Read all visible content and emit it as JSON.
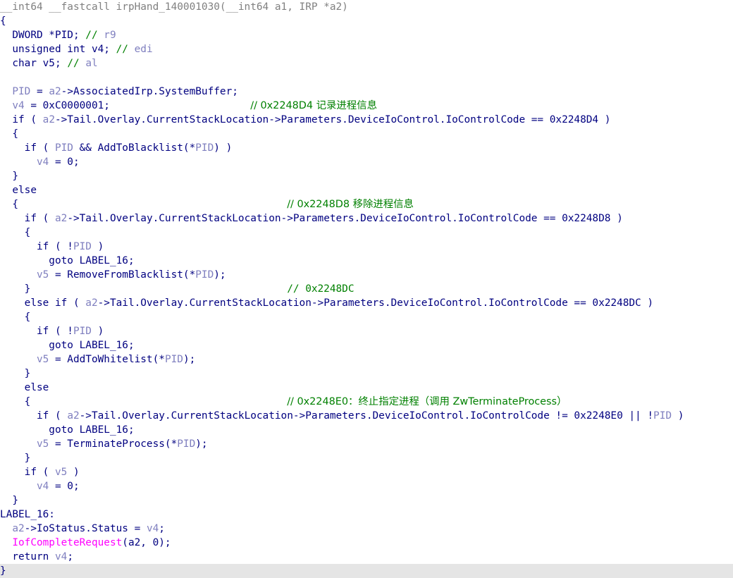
{
  "colors": {
    "default": "#000080",
    "variable": "#7f7fbf",
    "comment": "#008000",
    "import": "#ff00ff",
    "gray": "#808080",
    "selected_line_bg": "#e5e5e5"
  },
  "lines": [
    [
      {
        "t": "gray",
        "s": "__int64 __fastcall irpHand_140001030(__int64 a1, IRP *a2)"
      }
    ],
    [
      {
        "t": "sym",
        "s": "{"
      }
    ],
    [
      {
        "t": "plain",
        "s": "  DWORD *PID; "
      },
      {
        "t": "com",
        "s": "// "
      },
      {
        "t": "var",
        "s": "r9"
      }
    ],
    [
      {
        "t": "plain",
        "s": "  unsigned int v4; "
      },
      {
        "t": "com",
        "s": "// "
      },
      {
        "t": "var",
        "s": "edi"
      }
    ],
    [
      {
        "t": "plain",
        "s": "  char v5; "
      },
      {
        "t": "com",
        "s": "// "
      },
      {
        "t": "var",
        "s": "al"
      }
    ],
    [],
    [
      {
        "t": "plain",
        "s": "  "
      },
      {
        "t": "var",
        "s": "PID"
      },
      {
        "t": "plain",
        "s": " = "
      },
      {
        "t": "var",
        "s": "a2"
      },
      {
        "t": "plain",
        "s": "->AssociatedIrp.SystemBuffer;"
      }
    ],
    [
      {
        "t": "plain",
        "s": "  "
      },
      {
        "t": "var",
        "s": "v4"
      },
      {
        "t": "plain",
        "s": " = 0xC0000001;                       "
      },
      {
        "t": "com",
        "s": "// 0x2248D4 记录进程信息"
      }
    ],
    [
      {
        "t": "plain",
        "s": "  if ( "
      },
      {
        "t": "var",
        "s": "a2"
      },
      {
        "t": "plain",
        "s": "->Tail.Overlay.CurrentStackLocation->Parameters.DeviceIoControl.IoControlCode == 0x2248D4 )"
      }
    ],
    [
      {
        "t": "plain",
        "s": "  {"
      }
    ],
    [
      {
        "t": "plain",
        "s": "    if ( "
      },
      {
        "t": "var",
        "s": "PID"
      },
      {
        "t": "plain",
        "s": " && AddToBlacklist(*"
      },
      {
        "t": "var",
        "s": "PID"
      },
      {
        "t": "plain",
        "s": ") )"
      }
    ],
    [
      {
        "t": "plain",
        "s": "      "
      },
      {
        "t": "var",
        "s": "v4"
      },
      {
        "t": "plain",
        "s": " = 0;"
      }
    ],
    [
      {
        "t": "plain",
        "s": "  }"
      }
    ],
    [
      {
        "t": "plain",
        "s": "  else"
      }
    ],
    [
      {
        "t": "plain",
        "s": "  {                                            "
      },
      {
        "t": "com",
        "s": "// 0x2248D8 移除进程信息"
      }
    ],
    [
      {
        "t": "plain",
        "s": "    if ( "
      },
      {
        "t": "var",
        "s": "a2"
      },
      {
        "t": "plain",
        "s": "->Tail.Overlay.CurrentStackLocation->Parameters.DeviceIoControl.IoControlCode == 0x2248D8 )"
      }
    ],
    [
      {
        "t": "plain",
        "s": "    {"
      }
    ],
    [
      {
        "t": "plain",
        "s": "      if ( !"
      },
      {
        "t": "var",
        "s": "PID"
      },
      {
        "t": "plain",
        "s": " )"
      }
    ],
    [
      {
        "t": "plain",
        "s": "        goto LABEL_16;"
      }
    ],
    [
      {
        "t": "plain",
        "s": "      "
      },
      {
        "t": "var",
        "s": "v5"
      },
      {
        "t": "plain",
        "s": " = RemoveFromBlacklist(*"
      },
      {
        "t": "var",
        "s": "PID"
      },
      {
        "t": "plain",
        "s": ");"
      }
    ],
    [
      {
        "t": "plain",
        "s": "    }                                          "
      },
      {
        "t": "com",
        "s": "// 0x2248DC"
      }
    ],
    [
      {
        "t": "plain",
        "s": "    else if ( "
      },
      {
        "t": "var",
        "s": "a2"
      },
      {
        "t": "plain",
        "s": "->Tail.Overlay.CurrentStackLocation->Parameters.DeviceIoControl.IoControlCode == 0x2248DC )"
      }
    ],
    [
      {
        "t": "plain",
        "s": "    {"
      }
    ],
    [
      {
        "t": "plain",
        "s": "      if ( !"
      },
      {
        "t": "var",
        "s": "PID"
      },
      {
        "t": "plain",
        "s": " )"
      }
    ],
    [
      {
        "t": "plain",
        "s": "        goto LABEL_16;"
      }
    ],
    [
      {
        "t": "plain",
        "s": "      "
      },
      {
        "t": "var",
        "s": "v5"
      },
      {
        "t": "plain",
        "s": " = AddToWhitelist(*"
      },
      {
        "t": "var",
        "s": "PID"
      },
      {
        "t": "plain",
        "s": ");"
      }
    ],
    [
      {
        "t": "plain",
        "s": "    }"
      }
    ],
    [
      {
        "t": "plain",
        "s": "    else"
      }
    ],
    [
      {
        "t": "plain",
        "s": "    {                                          "
      },
      {
        "t": "com",
        "s": "// 0x2248E0：终止指定进程（调用 ZwTerminateProcess）"
      }
    ],
    [
      {
        "t": "plain",
        "s": "      if ( "
      },
      {
        "t": "var",
        "s": "a2"
      },
      {
        "t": "plain",
        "s": "->Tail.Overlay.CurrentStackLocation->Parameters.DeviceIoControl.IoControlCode != 0x2248E0 || !"
      },
      {
        "t": "var",
        "s": "PID"
      },
      {
        "t": "plain",
        "s": " )"
      }
    ],
    [
      {
        "t": "plain",
        "s": "        goto LABEL_16;"
      }
    ],
    [
      {
        "t": "plain",
        "s": "      "
      },
      {
        "t": "var",
        "s": "v5"
      },
      {
        "t": "plain",
        "s": " = TerminateProcess(*"
      },
      {
        "t": "var",
        "s": "PID"
      },
      {
        "t": "plain",
        "s": ");"
      }
    ],
    [
      {
        "t": "plain",
        "s": "    }"
      }
    ],
    [
      {
        "t": "plain",
        "s": "    if ( "
      },
      {
        "t": "var",
        "s": "v5"
      },
      {
        "t": "plain",
        "s": " )"
      }
    ],
    [
      {
        "t": "plain",
        "s": "      "
      },
      {
        "t": "var",
        "s": "v4"
      },
      {
        "t": "plain",
        "s": " = 0;"
      }
    ],
    [
      {
        "t": "plain",
        "s": "  }"
      }
    ],
    [
      {
        "t": "plain",
        "s": "LABEL_16:"
      }
    ],
    [
      {
        "t": "plain",
        "s": "  "
      },
      {
        "t": "var",
        "s": "a2"
      },
      {
        "t": "plain",
        "s": "->IoStatus.Status = "
      },
      {
        "t": "var",
        "s": "v4"
      },
      {
        "t": "plain",
        "s": ";"
      }
    ],
    [
      {
        "t": "plain",
        "s": "  "
      },
      {
        "t": "imp",
        "s": "IofCompleteRequest"
      },
      {
        "t": "plain",
        "s": "(a2, 0);"
      }
    ],
    [
      {
        "t": "plain",
        "s": "  return "
      },
      {
        "t": "var",
        "s": "v4"
      },
      {
        "t": "plain",
        "s": ";"
      }
    ],
    [
      {
        "t": "sym",
        "s": "}"
      }
    ]
  ],
  "selected_line": 40
}
